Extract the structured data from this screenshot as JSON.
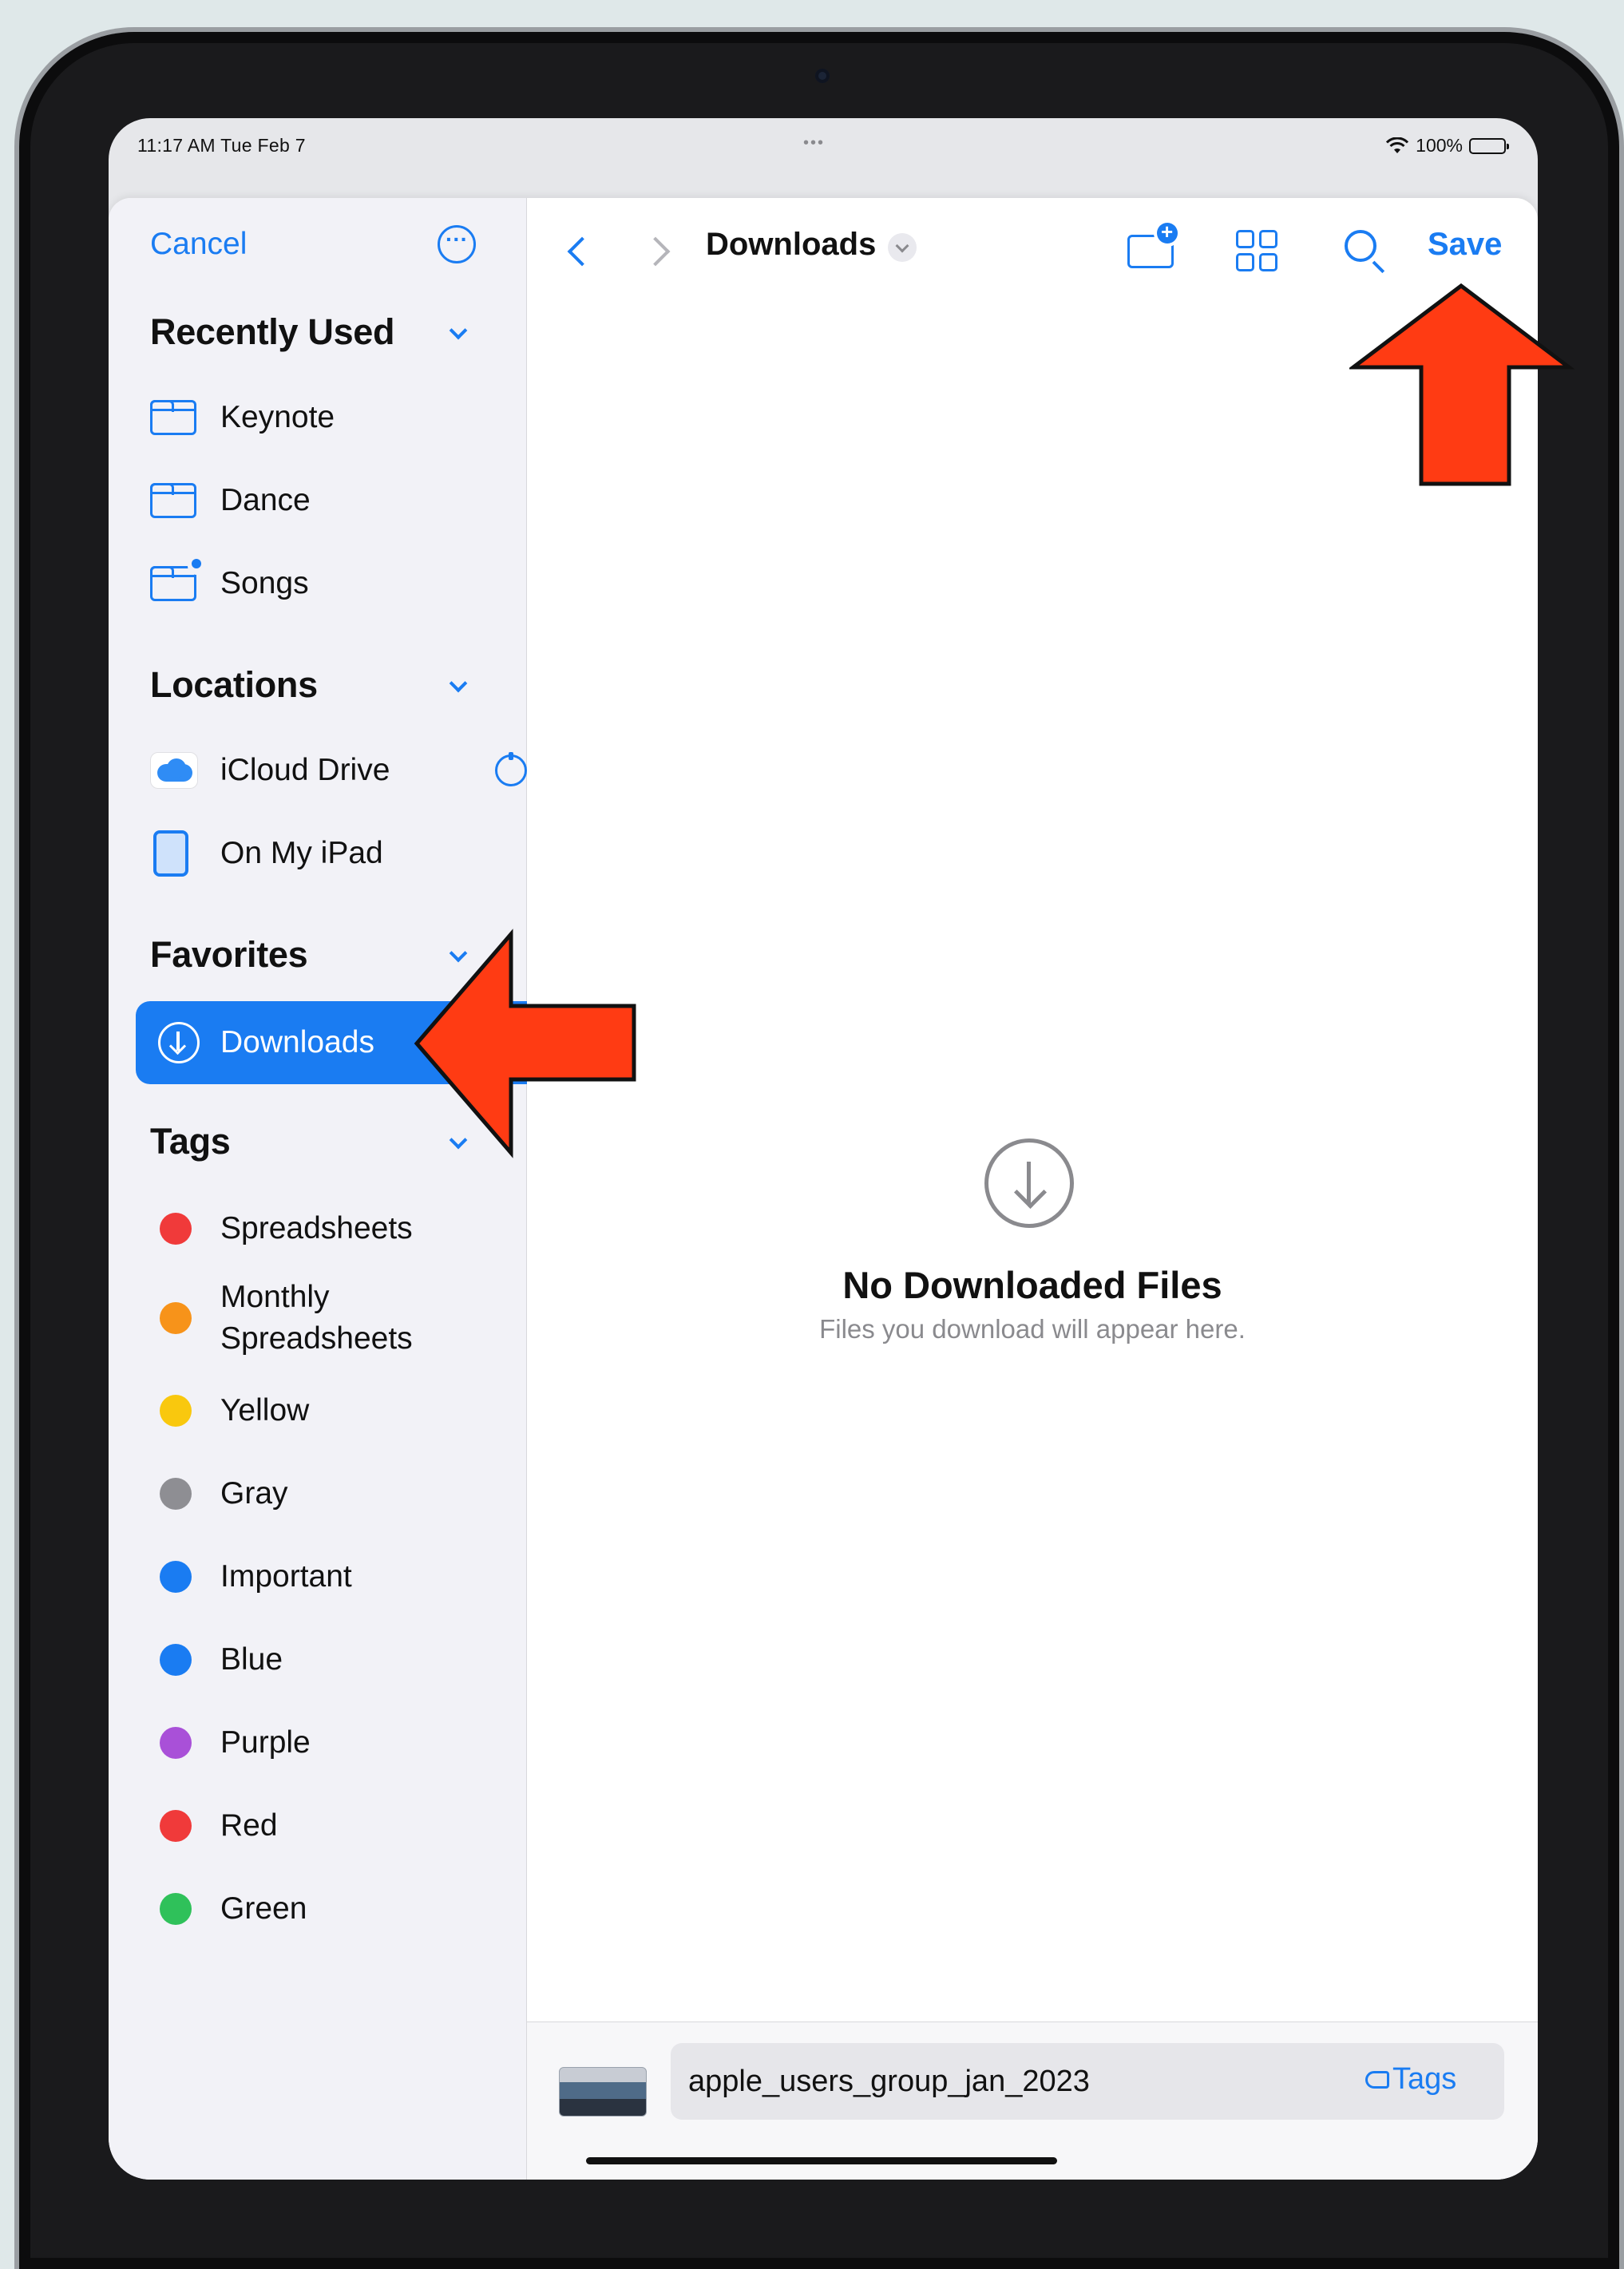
{
  "status_bar": {
    "time_date": "11:17 AM  Tue Feb 7",
    "dots": "•••",
    "battery": "100%"
  },
  "sidebar": {
    "cancel_label": "Cancel",
    "sections": {
      "recently_used": "Recently Used",
      "locations": "Locations",
      "favorites": "Favorites",
      "tags": "Tags"
    },
    "recently_used_items": [
      "Keynote",
      "Dance",
      "Songs"
    ],
    "locations_items": [
      "iCloud Drive",
      "On My iPad"
    ],
    "favorites_items": [
      "Downloads"
    ],
    "tags_items": [
      {
        "label": "Spreadsheets",
        "color": "#f03a3a"
      },
      {
        "label": "Monthly\nSpreadsheets",
        "color": "#f7931a"
      },
      {
        "label": "Yellow",
        "color": "#f9c80e"
      },
      {
        "label": "Gray",
        "color": "#8e8e93"
      },
      {
        "label": "Important",
        "color": "#1a7cf2"
      },
      {
        "label": "Blue",
        "color": "#1a7cf2"
      },
      {
        "label": "Purple",
        "color": "#a950d8"
      },
      {
        "label": "Red",
        "color": "#f03a3a"
      },
      {
        "label": "Green",
        "color": "#2fc15a"
      }
    ]
  },
  "main": {
    "title": "Downloads",
    "save_label": "Save",
    "empty_title": "No Downloaded Files",
    "empty_subtitle": "Files you download will appear here."
  },
  "bottom_bar": {
    "filename": "apple_users_group_jan_2023",
    "tags_label": "Tags"
  },
  "colors": {
    "accent": "#1a7cf2",
    "annotation_arrow": "#ff3b13"
  }
}
